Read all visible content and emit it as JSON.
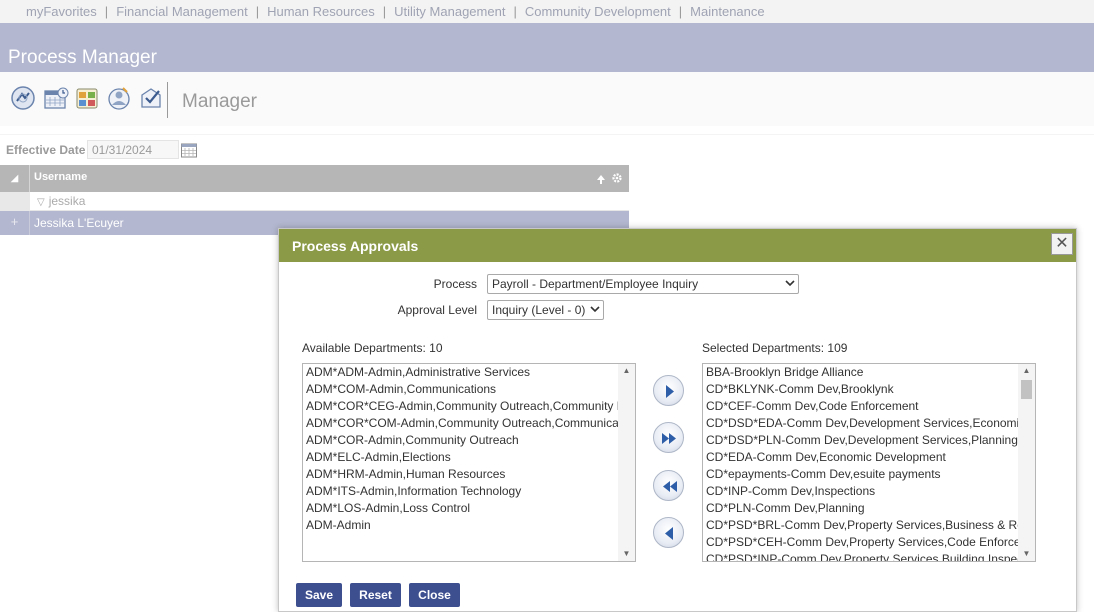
{
  "topnav": {
    "items": [
      "myFavorites",
      "Financial Management",
      "Human Resources",
      "Utility Management",
      "Community Development",
      "Maintenance"
    ],
    "separator": "|"
  },
  "app": {
    "title": "Process Manager"
  },
  "toolbar": {
    "title": "Manager",
    "icons": [
      "process-icon",
      "calendar-grid-icon",
      "approvals-icon",
      "user-process-icon",
      "checkmark-process-icon"
    ]
  },
  "effective_date": {
    "label": "Effective Date",
    "value": "01/31/2024"
  },
  "grid": {
    "column_header": "Username",
    "filter_value": "jessika",
    "rows": [
      {
        "username": "Jessika L'Ecuyer"
      }
    ]
  },
  "dialog": {
    "title": "Process Approvals",
    "close_glyph": "✕",
    "process_label": "Process",
    "process_value": "Payroll - Department/Employee Inquiry",
    "approval_level_label": "Approval Level",
    "approval_level_value": "Inquiry (Level - 0)",
    "available_title": "Available Departments: 10",
    "selected_title": "Selected Departments: 109",
    "available": [
      "ADM*ADM-Admin,Administrative Services",
      "ADM*COM-Admin,Communications",
      "ADM*COR*CEG-Admin,Community Outreach,Community Engagement",
      "ADM*COR*COM-Admin,Community Outreach,Communications",
      "ADM*COR-Admin,Community Outreach",
      "ADM*ELC-Admin,Elections",
      "ADM*HRM-Admin,Human Resources",
      "ADM*ITS-Admin,Information Technology",
      "ADM*LOS-Admin,Loss Control",
      "ADM-Admin"
    ],
    "selected": [
      "BBA-Brooklyn Bridge Alliance",
      "CD*BKLYNK-Comm Dev,Brooklynk",
      "CD*CEF-Comm Dev,Code Enforcement",
      "CD*DSD*EDA-Comm Dev,Development Services,Economic Development",
      "CD*DSD*PLN-Comm Dev,Development Services,Planning",
      "CD*EDA-Comm Dev,Economic Development",
      "CD*epayments-Comm Dev,esuite payments",
      "CD*INP-Comm Dev,Inspections",
      "CD*PLN-Comm Dev,Planning",
      "CD*PSD*BRL-Comm Dev,Property Services,Business & Rental Licensing",
      "CD*PSD*CEH-Comm Dev,Property Services,Code Enforcement",
      "CD*PSD*INP-Comm Dev,Property Services,Building Inspections"
    ],
    "buttons": {
      "save": "Save",
      "reset": "Reset",
      "close": "Close"
    }
  },
  "colors": {
    "title_bar": "#b3b7cf",
    "dialog_header": "#8a9a46",
    "action_button": "#3e4f90",
    "selected_row": "#b3b7cf"
  }
}
